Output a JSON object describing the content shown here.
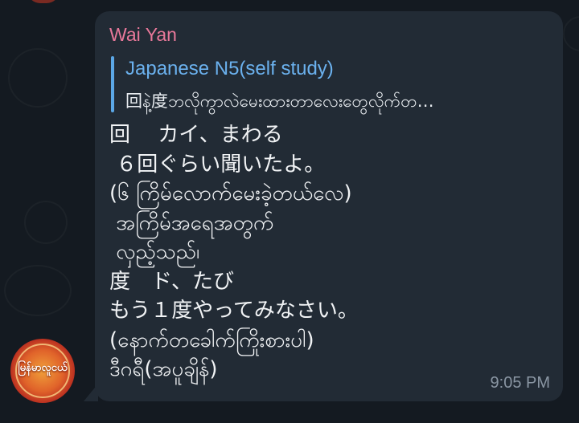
{
  "sender": {
    "name": "Wai Yan",
    "color": "#e8789a"
  },
  "reply": {
    "title": "Japanese N5(self study)",
    "text": "回နဲ့度ဘလိုကွာလဲမေးထားတာလေးတွေလိုက်တ…",
    "accent": "#5ba7e6"
  },
  "message": {
    "lines": [
      "回　 カイ、まわる",
      " ６回ぐらい聞いたよ。",
      "(၆ ကြိမ်လောက်မေးခဲ့တယ်လေ)",
      " အကြိမ်အရေအတွက်",
      " လှည့်သည်၊",
      "度　ド、たび",
      "もう１度やってみなさい。",
      "(နောက်တခေါက်ကြိုးစားပါ)",
      "ဒီဂရီ(အပူချိန်)"
    ]
  },
  "timestamp": "9:05 PM",
  "avatar": {
    "label": "မြန်မာလူငယ်"
  },
  "colors": {
    "background": "#141a21",
    "bubble": "#222b35",
    "text": "#f1f3f5",
    "timestamp": "#8a96a3"
  }
}
